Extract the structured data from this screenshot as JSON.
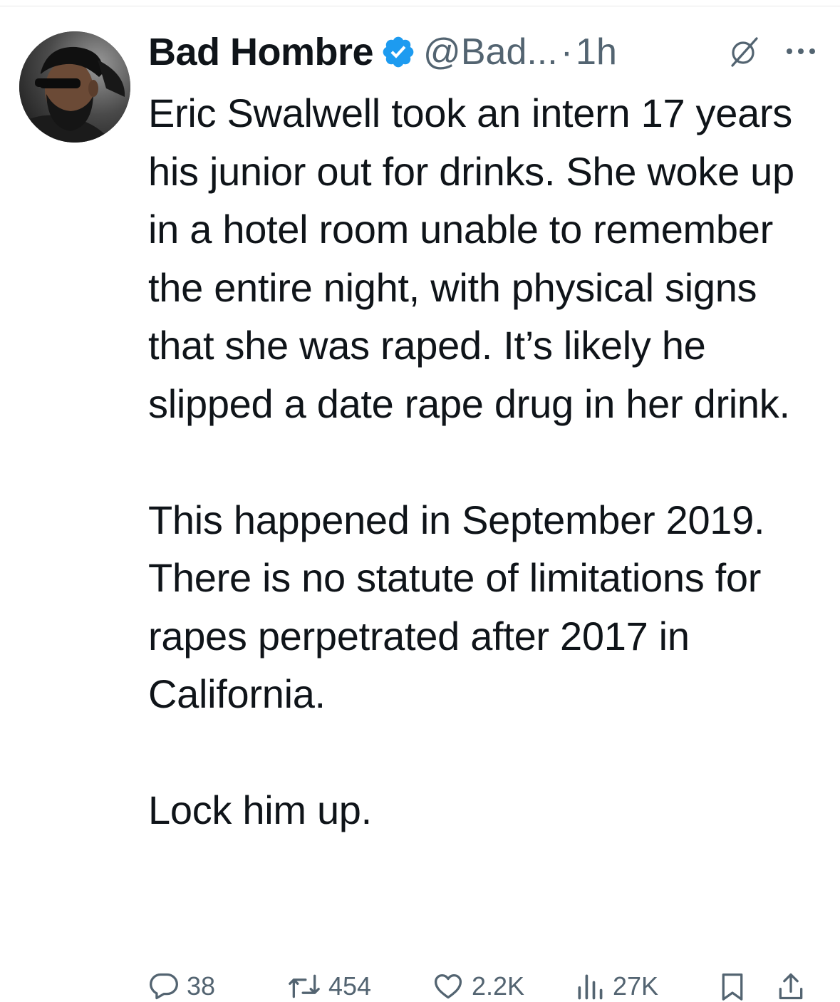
{
  "tweet": {
    "author": {
      "display_name": "Bad Hombre",
      "handle": "@Bad...",
      "verified": true,
      "verified_color": "#1d9bf0"
    },
    "separator": "·",
    "time": "1h",
    "icons": {
      "grok": "grok-icon",
      "more": "more-icon"
    },
    "paragraphs": [
      "Eric Swalwell took an intern 17 years his junior out for drinks. She woke up in a hotel room unable to remember the entire night, with physical signs that she was raped. It’s likely he slipped a date rape drug in her drink.",
      "This happened in September 2019. There is no statute of limitations for rapes perpetrated after 2017 in California.",
      "Lock him up."
    ],
    "metrics": {
      "replies": "38",
      "reposts": "454",
      "likes": "2.2K",
      "views": "27K"
    }
  },
  "colors": {
    "text_primary": "#0f1419",
    "text_secondary": "#536471",
    "accent": "#1d9bf0"
  }
}
